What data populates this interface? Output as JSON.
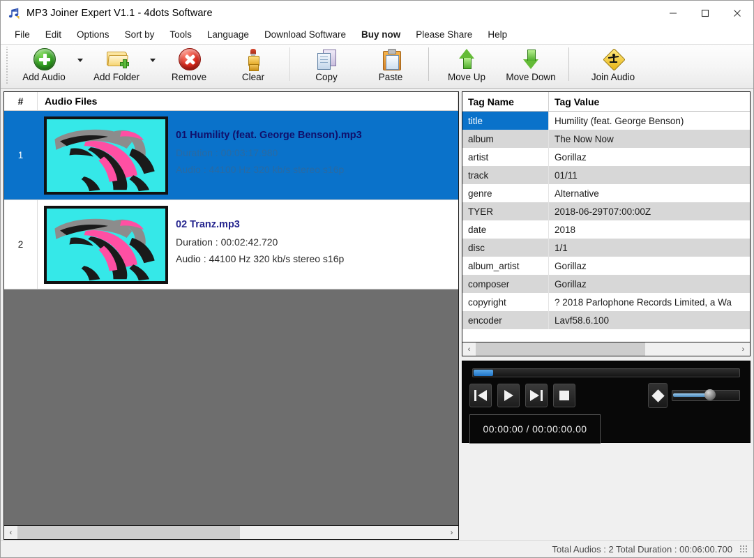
{
  "window": {
    "title": "MP3 Joiner Expert V1.1 - 4dots Software",
    "icon": "music-note-icon",
    "minimize_label": "─",
    "maximize_label": "☐",
    "close_label": "✕"
  },
  "menu": [
    {
      "label": "File",
      "bold": false
    },
    {
      "label": "Edit",
      "bold": false
    },
    {
      "label": "Options",
      "bold": false
    },
    {
      "label": "Sort by",
      "bold": false
    },
    {
      "label": "Tools",
      "bold": false
    },
    {
      "label": "Language",
      "bold": false
    },
    {
      "label": "Download Software",
      "bold": false
    },
    {
      "label": "Buy now",
      "bold": true
    },
    {
      "label": "Please Share",
      "bold": false
    },
    {
      "label": "Help",
      "bold": false
    }
  ],
  "toolbar": {
    "add_audio": "Add Audio",
    "add_folder": "Add Folder",
    "remove": "Remove",
    "clear": "Clear",
    "copy": "Copy",
    "paste": "Paste",
    "move_up": "Move Up",
    "move_down": "Move Down",
    "join_audio": "Join Audio"
  },
  "list": {
    "headers": {
      "number": "#",
      "name": "Audio Files"
    },
    "rows": [
      {
        "index": "1",
        "filename": "01 Humility (feat. George Benson).mp3",
        "duration": "Duration :  00:03:17.980",
        "audio": "Audio :  44100 Hz 320 kb/s stereo s16p",
        "selected": true
      },
      {
        "index": "2",
        "filename": "02 Tranz.mp3",
        "duration": "Duration : 00:02:42.720",
        "audio": "Audio :  44100 Hz 320 kb/s stereo s16p",
        "selected": false
      }
    ],
    "scroll_left_label": "‹",
    "scroll_right_label": "›"
  },
  "tags": {
    "headers": {
      "name": "Tag Name",
      "value": "Tag Value"
    },
    "rows": [
      {
        "name": "title",
        "value": "Humility (feat. George Benson)",
        "selected": true
      },
      {
        "name": "album",
        "value": "The Now Now",
        "selected": false
      },
      {
        "name": "artist",
        "value": "Gorillaz",
        "selected": false
      },
      {
        "name": "track",
        "value": "01/11",
        "selected": false
      },
      {
        "name": "genre",
        "value": "Alternative",
        "selected": false
      },
      {
        "name": "TYER",
        "value": "2018-06-29T07:00:00Z",
        "selected": false
      },
      {
        "name": "date",
        "value": "2018",
        "selected": false
      },
      {
        "name": "disc",
        "value": "1/1",
        "selected": false
      },
      {
        "name": "album_artist",
        "value": "Gorillaz",
        "selected": false
      },
      {
        "name": "composer",
        "value": "Gorillaz",
        "selected": false
      },
      {
        "name": "copyright",
        "value": "? 2018 Parlophone Records Limited, a Wa",
        "selected": false
      },
      {
        "name": "encoder",
        "value": "Lavf58.6.100",
        "selected": false
      }
    ],
    "scroll_left_label": "‹",
    "scroll_right_label": "›"
  },
  "player": {
    "time_display": "00:00:00 / 00:00:00.00",
    "buttons": {
      "previous": "previous-track-icon",
      "play": "play-icon",
      "next": "next-track-icon",
      "stop": "stop-icon",
      "mute": "mute-icon"
    }
  },
  "statusbar": {
    "text": "Total Audios : 2  Total Duration : 00:06:00.700"
  },
  "colors": {
    "selection_blue": "#0a72ca",
    "title_link": "#26268f",
    "album_art_bg": "#35e8e8",
    "album_art_pink": "#ff4fa3",
    "toolbar_bg": "#f4f4f4"
  }
}
